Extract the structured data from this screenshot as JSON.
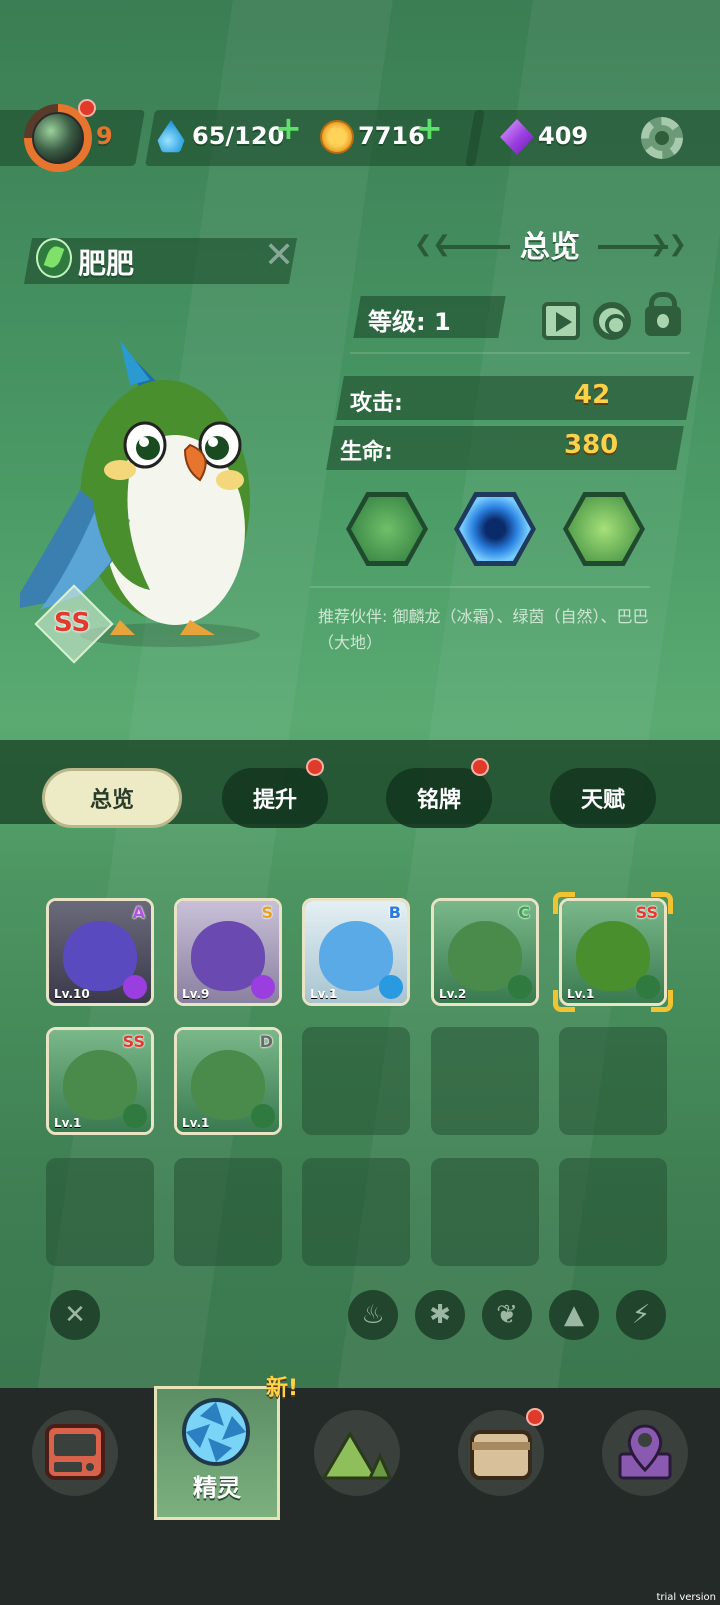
{
  "hud": {
    "level": "9",
    "water": "65/120",
    "coins": "7716",
    "gems": "409"
  },
  "pet": {
    "name": "肥肥",
    "grade": "SS"
  },
  "panel": {
    "title": "总览",
    "level_label": "等级: 1",
    "attack_label": "攻击:",
    "attack_value": "42",
    "hp_label": "生命:",
    "hp_value": "380",
    "recommend": "推荐伙伴: 御麟龙（冰霜）、绿茵（自然）、巴巴（大地）"
  },
  "tabs": [
    {
      "label": "总览",
      "active": true
    },
    {
      "label": "提升",
      "badge": true
    },
    {
      "label": "铭牌",
      "badge": true
    },
    {
      "label": "天赋",
      "badge": false
    }
  ],
  "cards": [
    {
      "grade": "A",
      "level": "Lv.10",
      "grade_color": "#b055e0",
      "element": "lightning"
    },
    {
      "grade": "S",
      "level": "Lv.9",
      "grade_color": "#e8a020",
      "element": "lightning"
    },
    {
      "grade": "B",
      "level": "Lv.1",
      "grade_color": "#2a7ae0",
      "element": "frost"
    },
    {
      "grade": "C",
      "level": "Lv.2",
      "grade_color": "#3aa84a",
      "element": "nature"
    },
    {
      "grade": "SS",
      "level": "Lv.1",
      "grade_color": "#e23a2e",
      "element": "nature",
      "selected": true
    },
    {
      "grade": "SS",
      "level": "Lv.1",
      "grade_color": "#e23a2e",
      "element": "nature"
    },
    {
      "grade": "D",
      "level": "Lv.1",
      "grade_color": "#6a6a6a",
      "element": "nature"
    }
  ],
  "filters": [
    "close-icon",
    "fire-icon",
    "frost-icon",
    "leaf-icon",
    "earth-icon",
    "lightning-icon"
  ],
  "nav": {
    "active_label": "精灵",
    "new_tag": "新!"
  },
  "watermark": "trial version",
  "colors": {
    "accent_yellow": "#f7d24a",
    "red_badge": "#e03a2a",
    "panel_dark": "#1f4a2e"
  }
}
